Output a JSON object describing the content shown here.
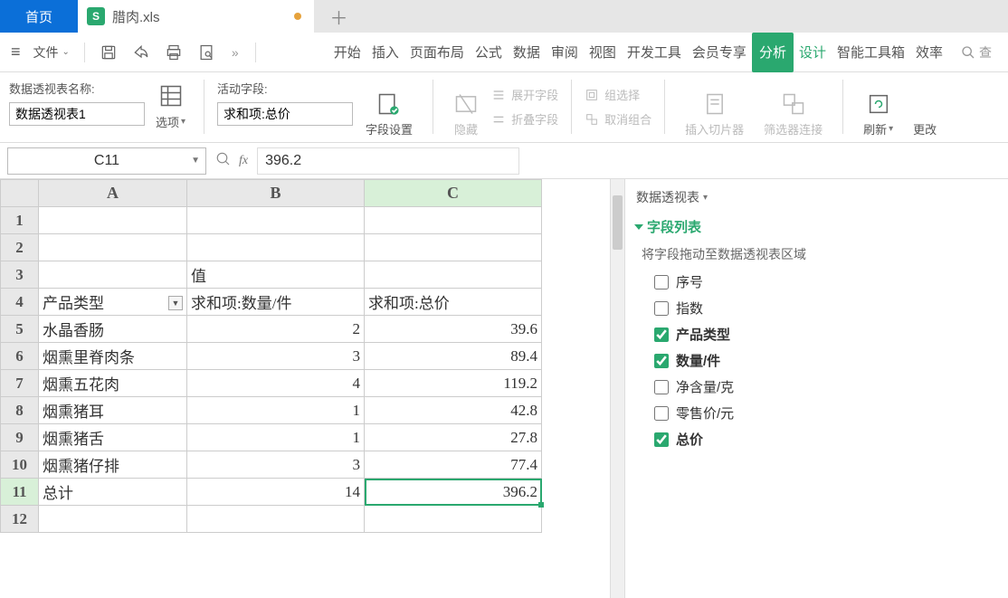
{
  "tabs": {
    "home": "首页",
    "file_name": "腊肉.xls",
    "app_icon_letter": "S"
  },
  "menu": {
    "file": "文件",
    "search_hint": "查",
    "ribbon": [
      "开始",
      "插入",
      "页面布局",
      "公式",
      "数据",
      "审阅",
      "视图",
      "开发工具",
      "会员专享",
      "分析",
      "设计",
      "智能工具箱",
      "效率"
    ]
  },
  "ribbon_panel": {
    "pivot_name_label": "数据透视表名称:",
    "pivot_name_value": "数据透视表1",
    "options": "选项",
    "active_field_label": "活动字段:",
    "active_field_value": "求和项:总价",
    "field_settings": "字段设置",
    "hide": "隐藏",
    "expand": "展开字段",
    "collapse": "折叠字段",
    "group_select": "组选择",
    "ungroup": "取消组合",
    "insert_slicer": "插入切片器",
    "filter_conn": "筛选器连接",
    "refresh": "刷新",
    "change": "更改"
  },
  "formula_bar": {
    "name_box": "C11",
    "value": "396.2"
  },
  "grid": {
    "cols": [
      "A",
      "B",
      "C"
    ],
    "rows": [
      {
        "n": 1,
        "A": "",
        "B": "",
        "C": ""
      },
      {
        "n": 2,
        "A": "",
        "B": "",
        "C": ""
      },
      {
        "n": 3,
        "A": "",
        "B": "值",
        "C": ""
      },
      {
        "n": 4,
        "A": "产品类型",
        "B": "求和项:数量/件",
        "C": "求和项:总价",
        "dd": true
      },
      {
        "n": 5,
        "A": "水晶香肠",
        "B": "2",
        "C": "39.6"
      },
      {
        "n": 6,
        "A": "烟熏里脊肉条",
        "B": "3",
        "C": "89.4"
      },
      {
        "n": 7,
        "A": "烟熏五花肉",
        "B": "4",
        "C": "119.2"
      },
      {
        "n": 8,
        "A": "烟熏猪耳",
        "B": "1",
        "C": "42.8"
      },
      {
        "n": 9,
        "A": "烟熏猪舌",
        "B": "1",
        "C": "27.8"
      },
      {
        "n": 10,
        "A": "烟熏猪仔排",
        "B": "3",
        "C": "77.4"
      },
      {
        "n": 11,
        "A": "总计",
        "B": "14",
        "C": "396.2"
      },
      {
        "n": 12,
        "A": "",
        "B": "",
        "C": ""
      }
    ],
    "selected": "C11"
  },
  "side": {
    "panel_title": "数据透视表",
    "section": "字段列表",
    "hint": "将字段拖动至数据透视表区域",
    "fields": [
      {
        "label": "序号",
        "checked": false
      },
      {
        "label": "指数",
        "checked": false
      },
      {
        "label": "产品类型",
        "checked": true
      },
      {
        "label": "数量/件",
        "checked": true
      },
      {
        "label": "净含量/克",
        "checked": false
      },
      {
        "label": "零售价/元",
        "checked": false
      },
      {
        "label": "总价",
        "checked": true
      }
    ]
  }
}
